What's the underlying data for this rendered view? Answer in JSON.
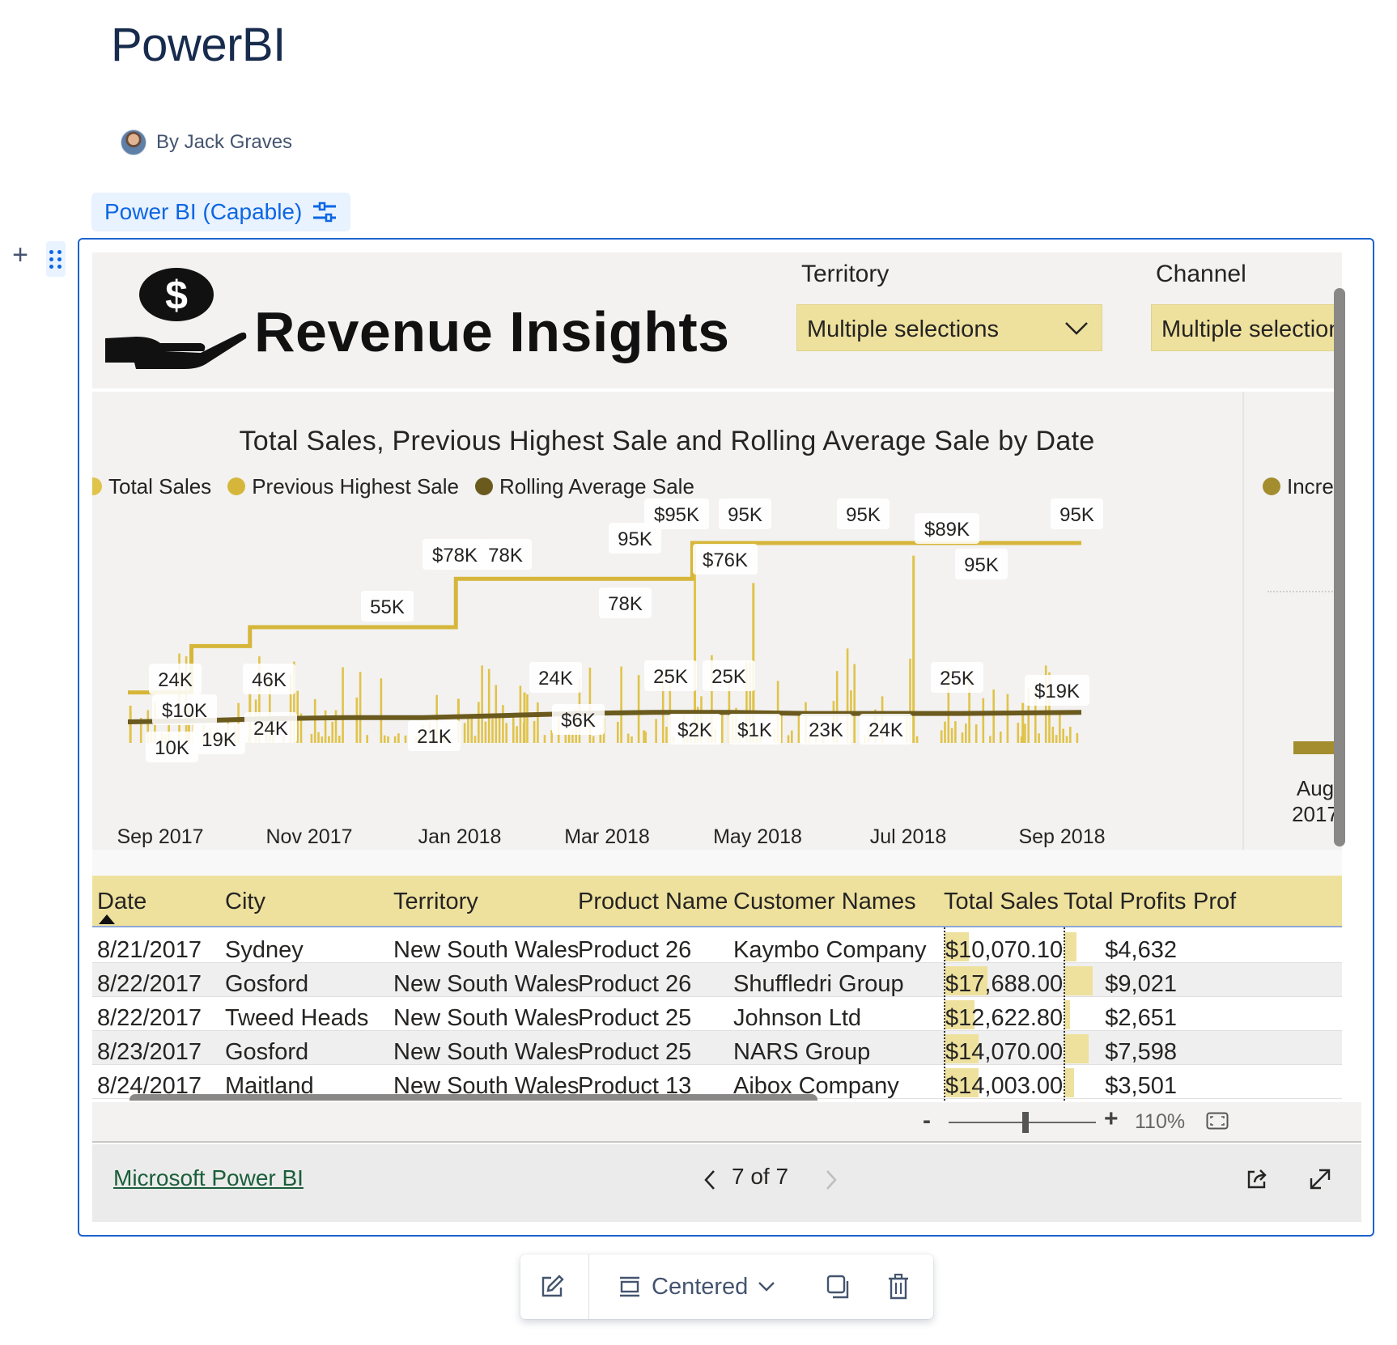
{
  "page": {
    "title": "PowerBI",
    "byline": "By Jack Graves",
    "macro_chip_label": "Power BI (Capable)"
  },
  "report": {
    "title": "Revenue Insights",
    "slicers": [
      {
        "label": "Territory",
        "value": "Multiple selections"
      },
      {
        "label": "Channel",
        "value": "Multiple selections"
      }
    ],
    "side_legend": "Increa",
    "side_axis_labels": [
      "Aug",
      "2017"
    ]
  },
  "chart_data": {
    "type": "line",
    "title": "Total Sales, Previous Highest Sale and Rolling Average Sale by Date",
    "legend": [
      "Total Sales",
      "Previous Highest Sale",
      "Rolling Average Sale"
    ],
    "legend_position": "top-left",
    "x_ticks": [
      "Sep 2017",
      "Nov 2017",
      "Jan 2018",
      "Mar 2018",
      "May 2018",
      "Jul 2018",
      "Sep 2018"
    ],
    "colors": {
      "total_sales": "#e0c34a",
      "previous_highest_sale": "#d6b63a",
      "rolling_average_sale": "#6b5a1e"
    },
    "series": [
      {
        "name": "Previous Highest Sale",
        "x": [
          "2017-08-21",
          "2017-09-15",
          "2017-10-06",
          "2017-10-08",
          "2017-12-28",
          "2018-03-31",
          "2018-08-31"
        ],
        "values": [
          24000,
          46000,
          46000,
          55000,
          78000,
          95000,
          95000
        ]
      },
      {
        "name": "Rolling Average Sale",
        "x": [
          "2017-08-21",
          "2017-09-15",
          "2017-10-15",
          "2017-11-15",
          "2017-12-15",
          "2018-01-15",
          "2018-02-15",
          "2018-03-15",
          "2018-04-15",
          "2018-05-15",
          "2018-06-15",
          "2018-07-15",
          "2018-08-31"
        ],
        "values": [
          10000,
          10500,
          11500,
          12000,
          12000,
          13000,
          14000,
          14500,
          14500,
          14000,
          14000,
          14000,
          14500
        ]
      },
      {
        "name": "Total Sales",
        "x": [
          "2017-08-22",
          "2017-09-14",
          "2017-10-08",
          "2017-12-29",
          "2018-01-24",
          "2018-03-12",
          "2018-04-01",
          "2018-04-24",
          "2018-06-26",
          "2018-08-08"
        ],
        "values": [
          17688,
          19000,
          24000,
          21000,
          24000,
          6000,
          95000,
          76000,
          89000,
          19000
        ]
      }
    ],
    "data_labels": [
      "24K",
      "$10K",
      "10K",
      "19K",
      "46K",
      "24K",
      "55K",
      "$78K",
      "78K",
      "21K",
      "24K",
      "$6K",
      "78K",
      "95K",
      "$95K",
      "95K",
      "$76K",
      "25K",
      "$2K",
      "25K",
      "$1K",
      "23K",
      "95K",
      "$89K",
      "95K",
      "25K",
      "24K",
      "95K",
      "$19K"
    ]
  },
  "table": {
    "columns": [
      "Date",
      "City",
      "Territory",
      "Product Name",
      "Customer Names",
      "Total Sales",
      "Total Profits",
      "Prof"
    ],
    "rows": [
      [
        "8/21/2017",
        "Sydney",
        "New South Wales",
        "Product 26",
        "Kaymbo Company",
        "$10,070.10",
        "$4,632"
      ],
      [
        "8/22/2017",
        "Gosford",
        "New South Wales",
        "Product 26",
        "Shuffledri Group",
        "$17,688.00",
        "$9,021"
      ],
      [
        "8/22/2017",
        "Tweed Heads",
        "New South Wales",
        "Product 25",
        "Johnson Ltd",
        "$12,622.80",
        "$2,651"
      ],
      [
        "8/23/2017",
        "Gosford",
        "New South Wales",
        "Product 25",
        "NARS Group",
        "$14,070.00",
        "$7,598"
      ],
      [
        "8/24/2017",
        "Maitland",
        "New South Wales",
        "Product 13",
        "Aibox Company",
        "$14,003.00",
        "$3,501"
      ]
    ],
    "sales_bar_fraction": [
      0.25,
      0.44,
      0.31,
      0.35,
      0.35
    ],
    "profit_bar_fraction": [
      0.14,
      0.32,
      0.06,
      0.27,
      0.11
    ]
  },
  "viewer": {
    "zoom_minus": "-",
    "zoom_plus": "+",
    "zoom_level": "110%",
    "zoom_slider_fraction": 0.52,
    "footer_link": "Microsoft Power BI",
    "page_indicator": "7 of 7"
  },
  "toolbar": {
    "layout_label": "Centered"
  }
}
